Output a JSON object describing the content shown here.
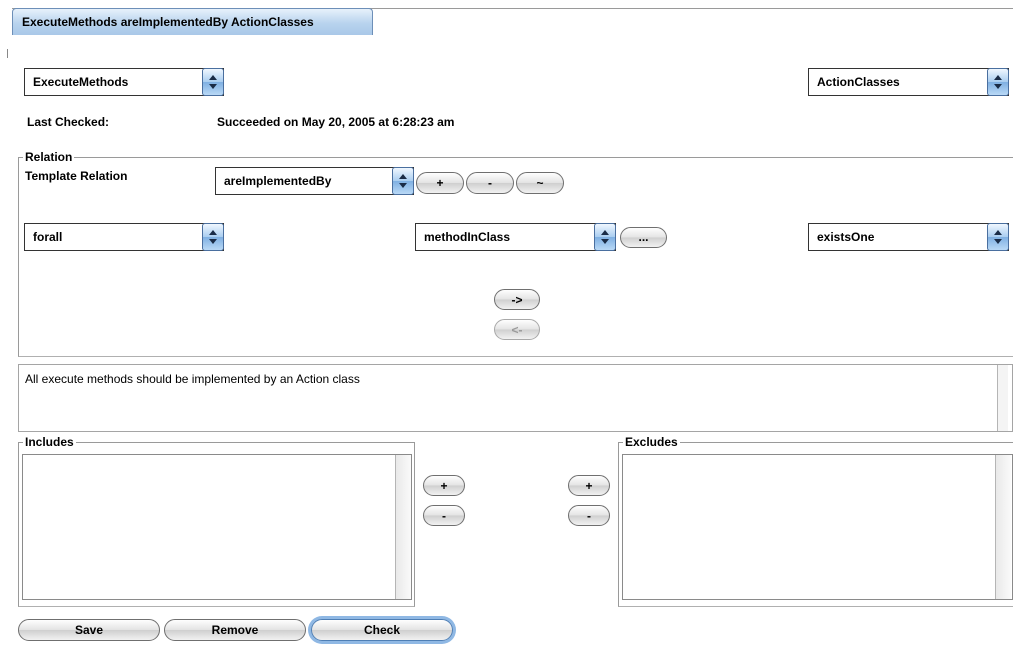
{
  "tab": {
    "title": "ExecuteMethods areImplementedBy ActionClasses"
  },
  "source_select": {
    "value": "ExecuteMethods"
  },
  "target_select": {
    "value": "ActionClasses"
  },
  "last_checked": {
    "label": "Last Checked:",
    "value": "Succeeded on May 20, 2005 at 6:28:23 am"
  },
  "relation": {
    "legend": "Relation",
    "template_label": "Template Relation",
    "template_value": "areImplementedBy",
    "add_label": "+",
    "remove_label": "-",
    "negate_label": "~",
    "quantifier_left": "forall",
    "relation_value": "methodInClass",
    "more_label": "...",
    "quantifier_right": "existsOne",
    "forward_label": "->",
    "backward_label": "<-"
  },
  "description": {
    "text": "All execute methods should be implemented by an Action class"
  },
  "includes": {
    "legend": "Includes",
    "add_label": "+",
    "remove_label": "-"
  },
  "excludes": {
    "legend": "Excludes",
    "add_label": "+",
    "remove_label": "-"
  },
  "footer": {
    "save_label": "Save",
    "remove_label": "Remove",
    "check_label": "Check"
  },
  "colors": {
    "tab_blue": "#b8d3ee",
    "focus_ring": "#8fb8e4"
  },
  "icons": [
    "popup-arrows-icon"
  ]
}
